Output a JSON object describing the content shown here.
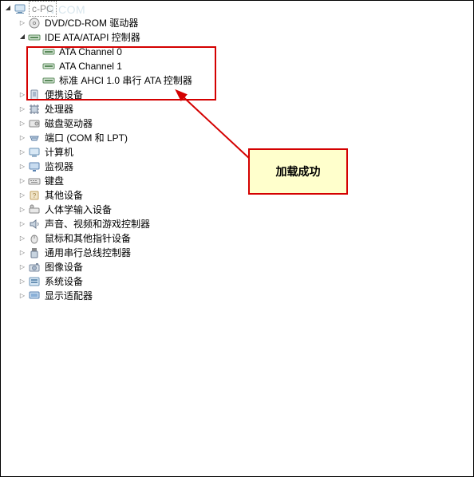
{
  "watermark": "N.COM",
  "root": {
    "label": "c-PC"
  },
  "categories": [
    {
      "label": "DVD/CD-ROM 驱动器",
      "icon": "dvd",
      "expanded": false
    },
    {
      "label": "IDE ATA/ATAPI 控制器",
      "icon": "ide",
      "expanded": true,
      "children": [
        {
          "label": "ATA Channel 0",
          "icon": "ide-ch"
        },
        {
          "label": "ATA Channel 1",
          "icon": "ide-ch"
        },
        {
          "label": "标准 AHCI 1.0 串行 ATA 控制器",
          "icon": "ide-ch"
        }
      ]
    },
    {
      "label": "便携设备",
      "icon": "portable",
      "expanded": false
    },
    {
      "label": "处理器",
      "icon": "cpu",
      "expanded": false
    },
    {
      "label": "磁盘驱动器",
      "icon": "disk",
      "expanded": false
    },
    {
      "label": "端口 (COM 和 LPT)",
      "icon": "port",
      "expanded": false
    },
    {
      "label": "计算机",
      "icon": "computer",
      "expanded": false
    },
    {
      "label": "监视器",
      "icon": "monitor",
      "expanded": false
    },
    {
      "label": "键盘",
      "icon": "keyboard",
      "expanded": false
    },
    {
      "label": "其他设备",
      "icon": "other",
      "expanded": false
    },
    {
      "label": "人体学输入设备",
      "icon": "hid",
      "expanded": false
    },
    {
      "label": "声音、视频和游戏控制器",
      "icon": "sound",
      "expanded": false
    },
    {
      "label": "鼠标和其他指针设备",
      "icon": "mouse",
      "expanded": false
    },
    {
      "label": "通用串行总线控制器",
      "icon": "usb",
      "expanded": false
    },
    {
      "label": "图像设备",
      "icon": "imaging",
      "expanded": false
    },
    {
      "label": "系统设备",
      "icon": "system",
      "expanded": false
    },
    {
      "label": "显示适配器",
      "icon": "display",
      "expanded": false
    }
  ],
  "callout": {
    "text": "加载成功"
  }
}
